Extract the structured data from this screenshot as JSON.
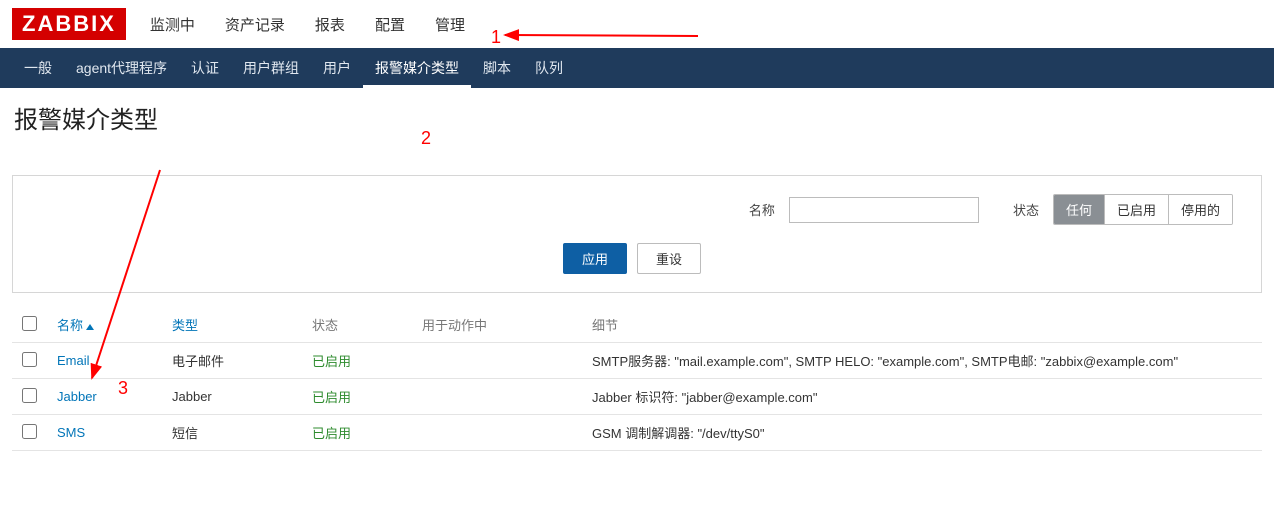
{
  "logo_text": "ZABBIX",
  "primary_nav": [
    {
      "label": "监测中"
    },
    {
      "label": "资产记录"
    },
    {
      "label": "报表"
    },
    {
      "label": "配置"
    },
    {
      "label": "管理"
    }
  ],
  "secondary_nav": [
    {
      "label": "一般"
    },
    {
      "label": "agent代理程序"
    },
    {
      "label": "认证"
    },
    {
      "label": "用户群组"
    },
    {
      "label": "用户"
    },
    {
      "label": "报警媒介类型",
      "active": true
    },
    {
      "label": "脚本"
    },
    {
      "label": "队列"
    }
  ],
  "page_title": "报警媒介类型",
  "filter": {
    "name_label": "名称",
    "name_value": "",
    "status_label": "状态",
    "toggles": [
      {
        "label": "任何",
        "active": true
      },
      {
        "label": "已启用"
      },
      {
        "label": "停用的"
      }
    ],
    "apply_label": "应用",
    "reset_label": "重设"
  },
  "table": {
    "headers": {
      "name": "名称",
      "type": "类型",
      "status": "状态",
      "used": "用于动作中",
      "details": "细节"
    },
    "rows": [
      {
        "name": "Email",
        "type": "电子邮件",
        "status": "已启用",
        "used": "",
        "details": "SMTP服务器: \"mail.example.com\", SMTP HELO: \"example.com\", SMTP电邮: \"zabbix@example.com\""
      },
      {
        "name": "Jabber",
        "type": "Jabber",
        "status": "已启用",
        "used": "",
        "details": "Jabber 标识符: \"jabber@example.com\""
      },
      {
        "name": "SMS",
        "type": "短信",
        "status": "已启用",
        "used": "",
        "details": "GSM 调制解调器: \"/dev/ttyS0\""
      }
    ]
  },
  "annotations": {
    "one": "1",
    "two": "2",
    "three": "3"
  }
}
